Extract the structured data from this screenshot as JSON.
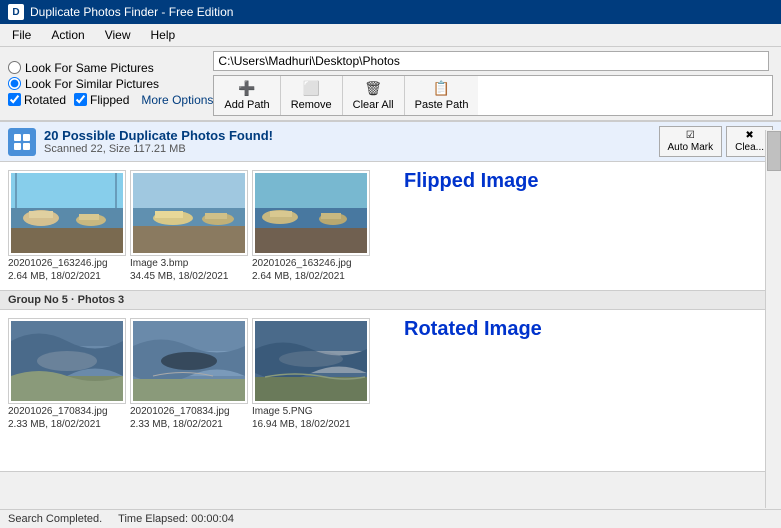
{
  "titleBar": {
    "title": "Duplicate Photos Finder - Free Edition",
    "iconLabel": "D"
  },
  "menuBar": {
    "items": [
      "File",
      "Action",
      "View",
      "Help"
    ]
  },
  "searchOptions": {
    "samePictures": "Look For Same Pictures",
    "similarPictures": "Look For Similar Pictures",
    "rotated": "Rotated",
    "flipped": "Flipped",
    "moreOptions": "More Options"
  },
  "toolbar": {
    "pathValue": "C:\\Users\\Madhuri\\Desktop\\Photos",
    "buttons": [
      {
        "label": "Add Path",
        "icon": "➕"
      },
      {
        "label": "Remove",
        "icon": "⬜"
      },
      {
        "label": "Clear All",
        "icon": "🗑"
      },
      {
        "label": "Paste Path",
        "icon": "📋"
      }
    ]
  },
  "results": {
    "title": "20 Possible Duplicate Photos Found!",
    "subtitle": "Scanned 22, Size 117.21 MB",
    "autoMarkLabel": "Auto Mark",
    "clearLabel": "Clea..."
  },
  "groups": [
    {
      "header": "",
      "annotation": "Flipped Image",
      "images": [
        {
          "filename": "20201026_163246.jpg",
          "size": "2.64 MB, 18/02/2021"
        },
        {
          "filename": "Image 3.bmp",
          "size": "34.45 MB, 18/02/2021"
        },
        {
          "filename": "20201026_163246.jpg",
          "size": "2.64 MB, 18/02/2021"
        }
      ]
    },
    {
      "header": "Group No 5  ·  Photos 3",
      "annotation": "Rotated Image",
      "images": [
        {
          "filename": "20201026_170834.jpg",
          "size": "2.33 MB, 18/02/2021"
        },
        {
          "filename": "20201026_170834.jpg",
          "size": "2.33 MB, 18/02/2021"
        },
        {
          "filename": "Image 5.PNG",
          "size": "16.94 MB, 18/02/2021"
        }
      ]
    }
  ],
  "statusBar": {
    "status": "Search Completed.",
    "timeLabel": "Time Elapsed: 00:00:04"
  }
}
